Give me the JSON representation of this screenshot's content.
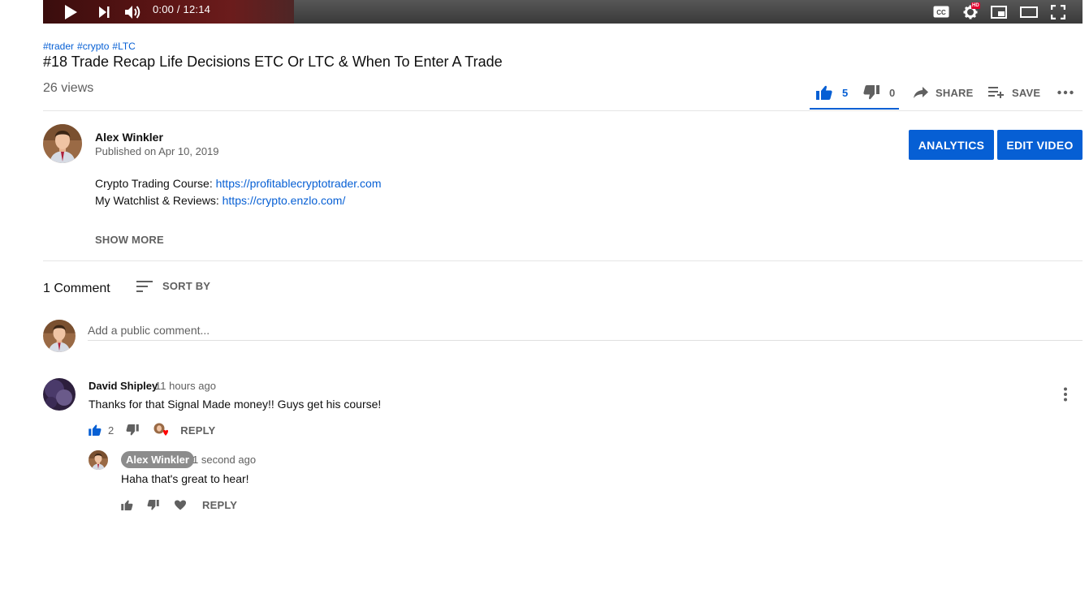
{
  "player": {
    "time": "0:00 / 12:14",
    "icons": [
      "play-icon",
      "next-icon",
      "volume-icon",
      "captions-icon",
      "settings-icon",
      "miniplayer-icon",
      "theater-icon",
      "fullscreen-icon"
    ],
    "hd_label": "HD"
  },
  "video": {
    "hashtags": [
      "#trader",
      "#crypto",
      "#LTC"
    ],
    "title": "#18 Trade Recap Life Decisions ETC Or LTC & When To Enter A Trade",
    "views": "26 views"
  },
  "actions": {
    "likes": "5",
    "dislikes": "0",
    "share_label": "SHARE",
    "save_label": "SAVE"
  },
  "owner": {
    "name": "Alex Winkler",
    "published": "Published on Apr 10, 2019",
    "analytics_label": "ANALYTICS",
    "edit_label": "EDIT VIDEO"
  },
  "description": {
    "line1_prefix": "Crypto Trading Course: ",
    "line1_link": "https://profitablecryptotrader.com",
    "line2_prefix": "My Watchlist & Reviews: ",
    "line2_link": "https://crypto.enzlo.com/",
    "show_more": "SHOW MORE"
  },
  "comments": {
    "count_label": "1 Comment",
    "sort_label": "SORT BY",
    "input_placeholder": "Add a public comment...",
    "items": [
      {
        "author": "David Shipley",
        "time": "11 hours ago",
        "text": "Thanks for that Signal Made money!! Guys get his course!",
        "likes": "2",
        "reply_label": "REPLY",
        "replies": [
          {
            "author": "Alex Winkler",
            "time": "1 second ago",
            "text": "Haha that's great to hear!",
            "reply_label": "REPLY"
          }
        ]
      }
    ]
  },
  "colors": {
    "accent": "#065fd4",
    "text_secondary": "#606060",
    "heart": "#ff0000"
  }
}
